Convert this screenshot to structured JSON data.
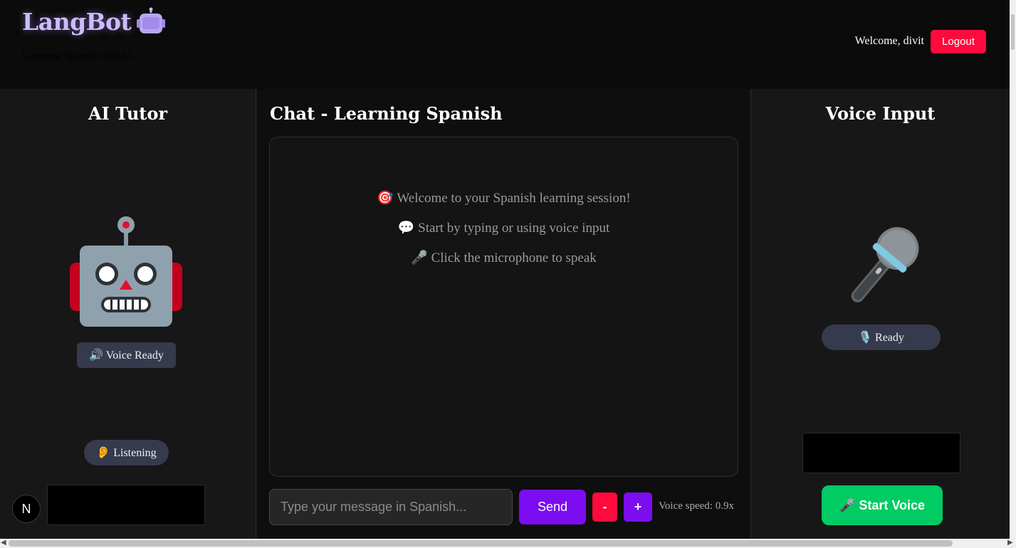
{
  "header": {
    "title": "LangBot",
    "subtitle": "Learning Spanish with AI",
    "welcome": "Welcome, divit",
    "logout_label": "Logout"
  },
  "left_panel": {
    "title": "AI Tutor",
    "avatar_icon": "robot-icon",
    "voice_status": "🔊 Voice Ready",
    "listening_status": "👂 Listening",
    "badge_letter": "N"
  },
  "chat": {
    "title": "Chat - Learning Spanish",
    "messages": [
      "🎯 Welcome to your Spanish learning session!",
      "💬 Start by typing or using voice input",
      "🎤 Click the microphone to speak"
    ],
    "input_placeholder": "Type your message in Spanish...",
    "send_label": "Send",
    "minus_label": "-",
    "plus_label": "+",
    "voice_speed": "Voice speed: 0.9x"
  },
  "right_panel": {
    "title": "Voice Input",
    "mic_icon": "microphone-icon",
    "status": "🎙️ Ready",
    "start_label": "🎤 Start Voice"
  },
  "colors": {
    "accent_purple": "#7b0df0",
    "logout_red": "#ff0a3d",
    "start_green": "#00cc63",
    "brand_lavender": "#cbbdf7"
  }
}
